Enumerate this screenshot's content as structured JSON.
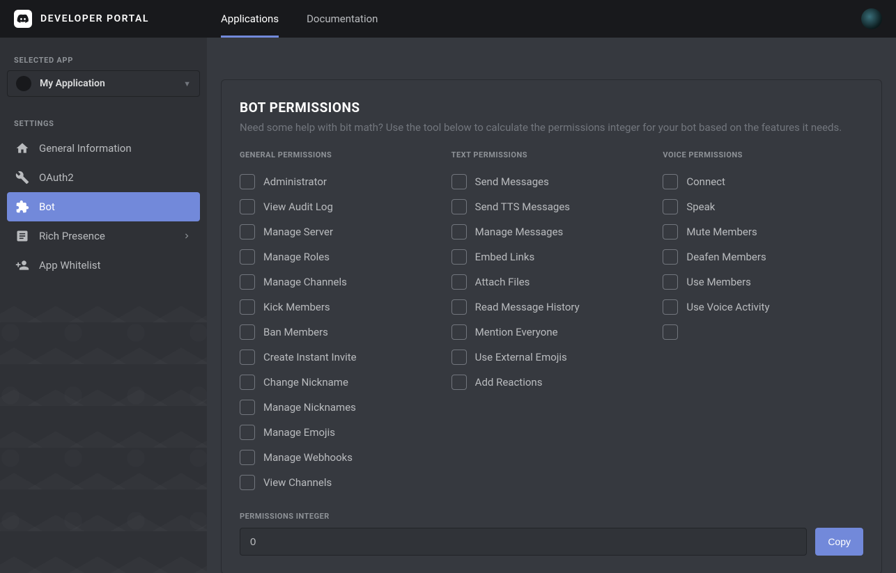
{
  "header": {
    "brand": "DEVELOPER PORTAL",
    "tabs": [
      {
        "label": "Applications",
        "active": true
      },
      {
        "label": "Documentation",
        "active": false
      }
    ]
  },
  "sidebar": {
    "selected_app_heading": "SELECTED APP",
    "selected_app_name": "My Application",
    "settings_heading": "SETTINGS",
    "items": [
      {
        "label": "General Information",
        "icon": "home-icon",
        "active": false,
        "has_arrow": false
      },
      {
        "label": "OAuth2",
        "icon": "wrench-icon",
        "active": false,
        "has_arrow": false
      },
      {
        "label": "Bot",
        "icon": "puzzle-icon",
        "active": true,
        "has_arrow": false
      },
      {
        "label": "Rich Presence",
        "icon": "note-icon",
        "active": false,
        "has_arrow": true
      },
      {
        "label": "App Whitelist",
        "icon": "user-add-icon",
        "active": false,
        "has_arrow": false
      }
    ]
  },
  "panel": {
    "title": "BOT PERMISSIONS",
    "description": "Need some help with bit math? Use the tool below to calculate the permissions integer for your bot based on the features it needs.",
    "columns": [
      {
        "heading": "GENERAL PERMISSIONS",
        "items": [
          "Administrator",
          "View Audit Log",
          "Manage Server",
          "Manage Roles",
          "Manage Channels",
          "Kick Members",
          "Ban Members",
          "Create Instant Invite",
          "Change Nickname",
          "Manage Nicknames",
          "Manage Emojis",
          "Manage Webhooks",
          "View Channels"
        ]
      },
      {
        "heading": "TEXT PERMISSIONS",
        "items": [
          "Send Messages",
          "Send TTS Messages",
          "Manage Messages",
          "Embed Links",
          "Attach Files",
          "Read Message History",
          "Mention Everyone",
          "Use External Emojis",
          "Add Reactions"
        ]
      },
      {
        "heading": "VOICE PERMISSIONS",
        "items": [
          "Connect",
          "Speak",
          "Mute Members",
          "Deafen Members",
          "Use Members",
          "Use Voice Activity",
          ""
        ]
      }
    ],
    "integer_heading": "PERMISSIONS INTEGER",
    "integer_value": "0",
    "copy_label": "Copy"
  }
}
